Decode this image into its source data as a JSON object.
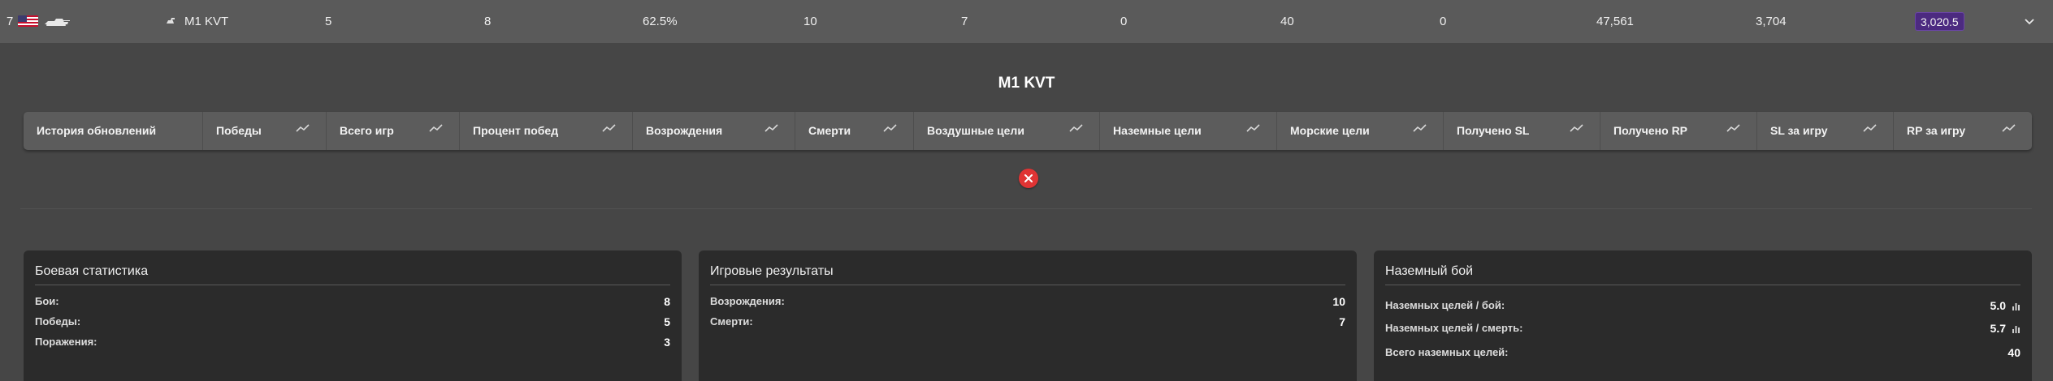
{
  "row": {
    "rank": "7",
    "vehicle_name": "M1 KVT",
    "col_victories": "5",
    "col_battles": "8",
    "col_winrate": "62.5%",
    "col_respawns": "10",
    "col_deaths": "7",
    "col_air_kills": "0",
    "col_ground_kills": "40",
    "col_naval_kills": "0",
    "col_sl": "47,561",
    "col_rp": "3,704",
    "col_br": "3,020.5"
  },
  "title": "M1 KVT",
  "history_headers": [
    "История обновлений",
    "Победы",
    "Всего игр",
    "Процент побед",
    "Возрождения",
    "Смерти",
    "Воздушные цели",
    "Наземные цели",
    "Морские цели",
    "Получено SL",
    "Получено RP",
    "SL за игру",
    "RP за игру"
  ],
  "cards": {
    "battle": {
      "title": "Боевая статистика",
      "rows": [
        {
          "label": "Бои:",
          "value": "8"
        },
        {
          "label": "Победы:",
          "value": "5"
        },
        {
          "label": "Поражения:",
          "value": "3"
        }
      ]
    },
    "results": {
      "title": "Игровые результаты",
      "rows": [
        {
          "label": "Возрождения:",
          "value": "10"
        },
        {
          "label": "Смерти:",
          "value": "7"
        }
      ]
    },
    "ground": {
      "title": "Наземный бой",
      "rows": [
        {
          "label": "Наземных целей / бой:",
          "value": "5.0"
        },
        {
          "label": "Наземных целей / смерть:",
          "value": "5.7"
        },
        {
          "label": "Всего наземных целей:",
          "value": "40"
        }
      ]
    }
  },
  "icons": {
    "flag": "usa-flag-icon",
    "vehicle": "tank-icon",
    "trend": "trend-line-icon",
    "close": "close-icon",
    "expand": "chevron-down-icon",
    "bar_chart": "bar-chart-icon"
  },
  "colors": {
    "br_badge": "#4c2a80",
    "close_button": "#e03434",
    "card_bg": "#2b2b2b"
  }
}
